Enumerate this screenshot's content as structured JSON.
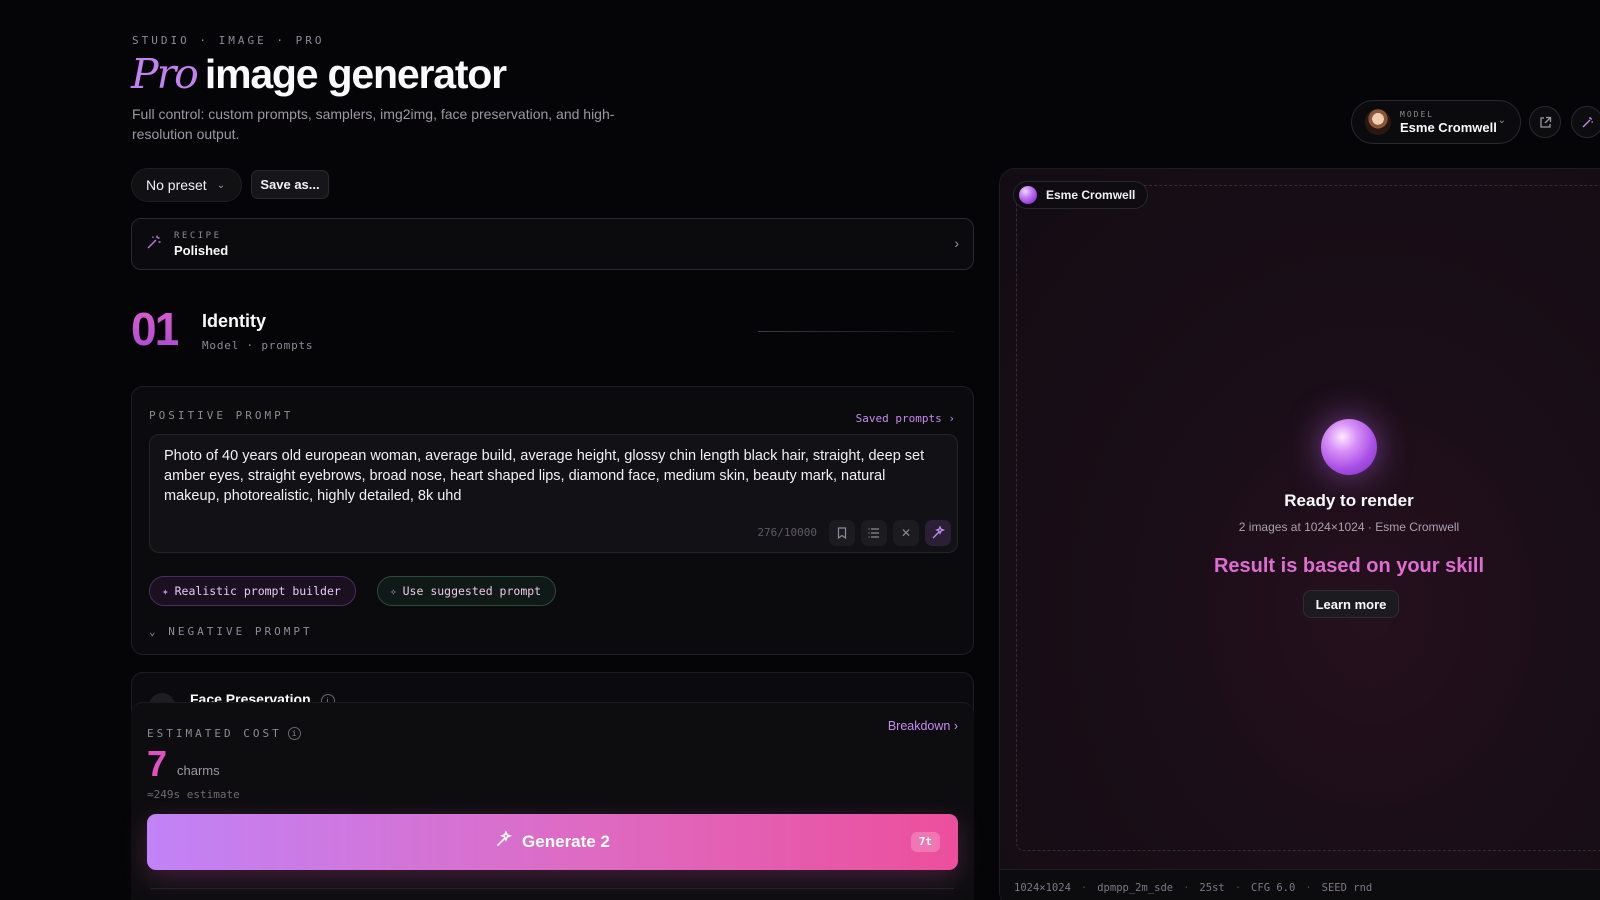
{
  "header": {
    "eyebrow": "STUDIO · IMAGE · PRO",
    "title_accent": "Pro",
    "title": "image generator",
    "subtitle": "Full control: custom prompts, samplers, img2img, face preservation, and high-resolution output."
  },
  "model_selector": {
    "label": "MODEL",
    "name": "Esme Cromwell",
    "chevron_icon": "chevron-down-icon"
  },
  "toolbar_icons": [
    "external-link-icon",
    "magic-wand-icon"
  ],
  "preset": {
    "value": "No preset",
    "save_label": "Save as..."
  },
  "recipe": {
    "label": "RECIPE",
    "value": "Polished"
  },
  "section": {
    "number": "01",
    "title": "Identity",
    "subtitle": "Model · prompts"
  },
  "prompt": {
    "label": "POSITIVE PROMPT",
    "saved_link": "Saved prompts ›",
    "text": "Photo of 40 years old european woman, average build, average height, glossy chin length black hair, straight, deep set amber eyes, straight eyebrows, broad nose, heart shaped lips, diamond face, medium skin, beauty mark, natural makeup, photorealistic, highly detailed, 8k uhd",
    "counter": "276/10000",
    "tools": [
      "bookmark-icon",
      "list-icon",
      "clear-icon",
      "sparkle-icon"
    ],
    "builder_chip": "Realistic prompt builder",
    "suggest_chip": "Use suggested prompt",
    "negative_toggle": "NEGATIVE PROMPT"
  },
  "face_preservation": {
    "title": "Face Preservation"
  },
  "cost": {
    "label": "ESTIMATED COST",
    "breakdown": "Breakdown ›",
    "value": "7",
    "unit": "charms",
    "estimate": "≈249s estimate",
    "generate_label": "Generate 2",
    "generate_badge": "7t"
  },
  "preview": {
    "chip_name": "Esme Cromwell",
    "ready_title": "Ready to render",
    "ready_sub": "2 images at 1024×1024 · Esme Cromwell",
    "result_text": "Result is based on your skill",
    "learn_more": "Learn more"
  },
  "footer": {
    "resolution": "1024×1024",
    "sampler": "dpmpp_2m_sde",
    "steps": "25st",
    "cfg": "CFG 6.0",
    "seed": "SEED rnd"
  },
  "colors": {
    "accent_purple": "#c183f7",
    "accent_pink": "#ec4f9c",
    "background": "#050507"
  }
}
